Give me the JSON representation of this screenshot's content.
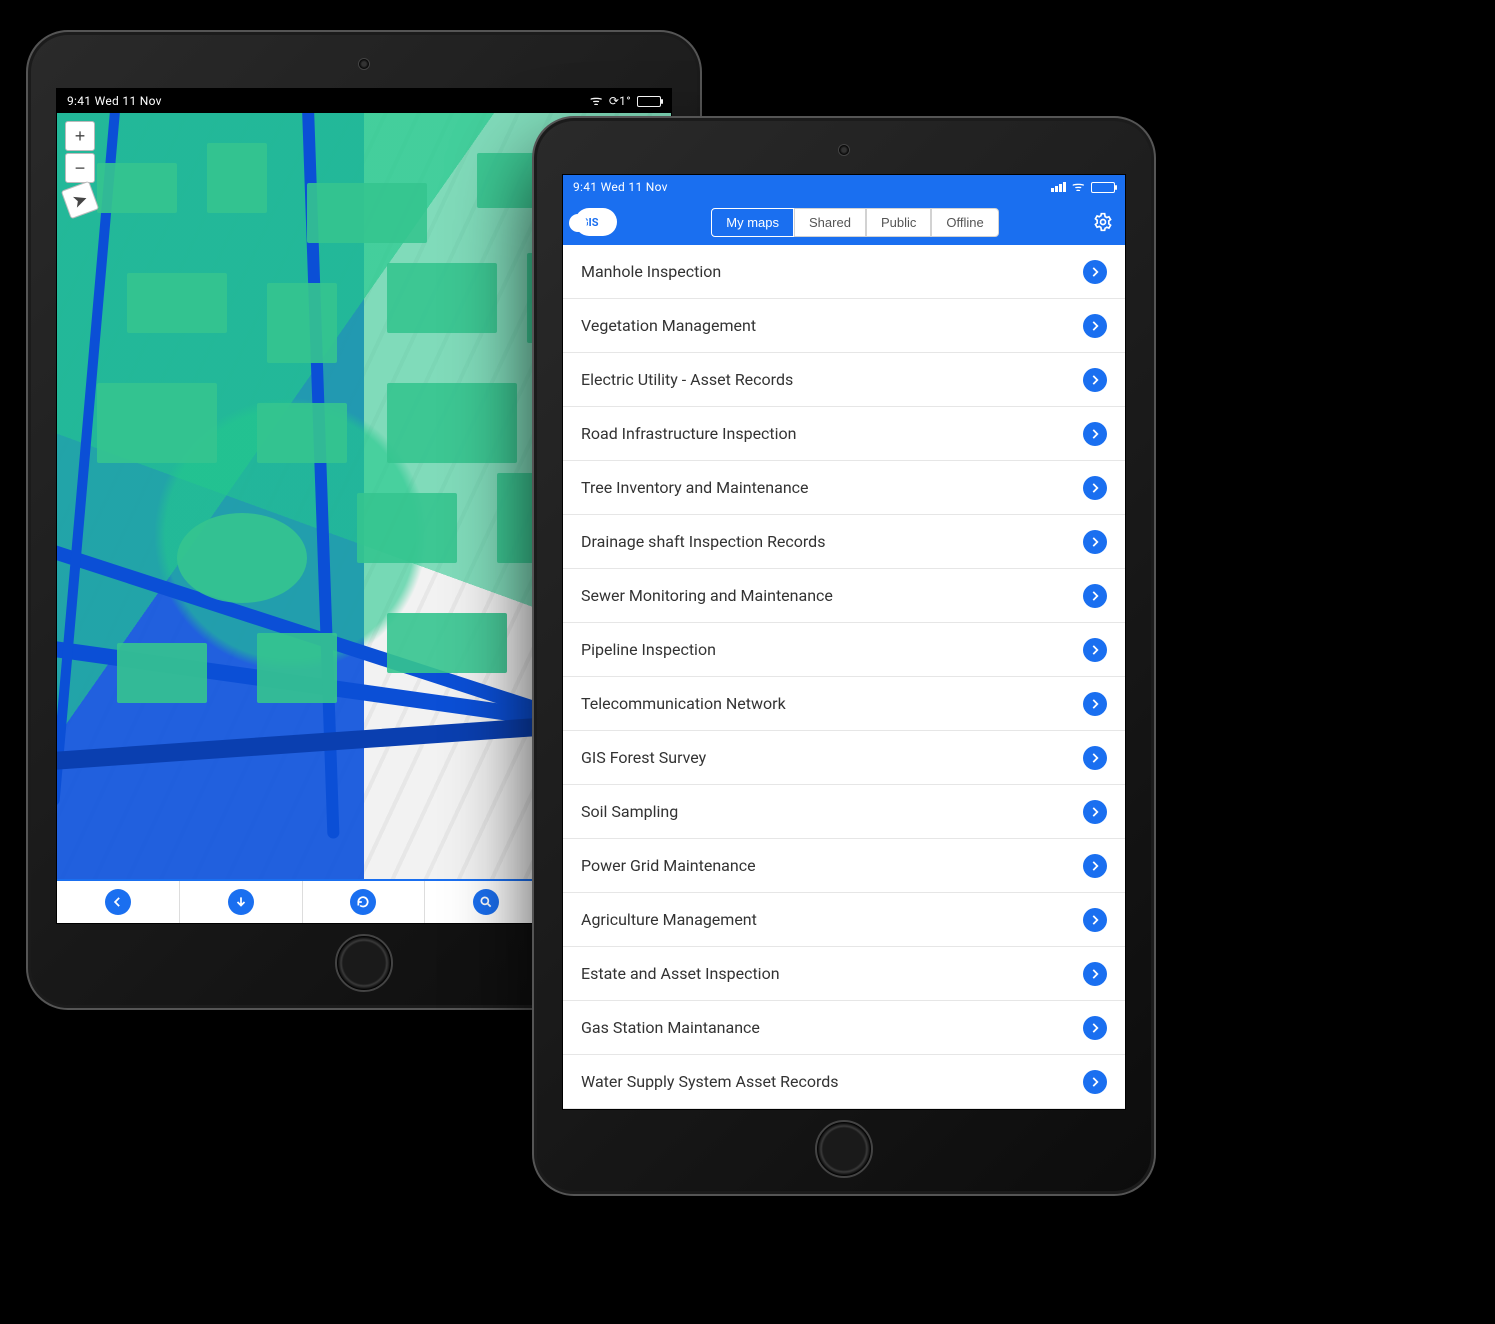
{
  "status": {
    "time": "9:41",
    "date": "Wed 11 Nov"
  },
  "brand": "GIS",
  "header": {
    "tabs": [
      {
        "label": "My maps",
        "active": true
      },
      {
        "label": "Shared",
        "active": false
      },
      {
        "label": "Public",
        "active": false
      },
      {
        "label": "Offline",
        "active": false
      }
    ]
  },
  "maps": [
    "Manhole Inspection",
    "Vegetation Management",
    "Electric Utility - Asset Records",
    "Road Infrastructure Inspection",
    "Tree Inventory and Maintenance",
    "Drainage shaft Inspection Records",
    "Sewer Monitoring and Maintenance",
    "Pipeline Inspection",
    "Telecommunication Network",
    "GIS Forest Survey",
    "Soil Sampling",
    "Power Grid Maintenance",
    "Agriculture Management",
    "Estate and Asset Inspection",
    "Gas Station Maintanance",
    "Water Supply System Asset Records"
  ],
  "map_controls": {
    "zoom_in": "+",
    "zoom_out": "−",
    "locate": "➤"
  },
  "bottom_icons": [
    "undo-icon",
    "download-icon",
    "refresh-icon",
    "zoom-icon",
    "more-icon"
  ],
  "colors": {
    "accent": "#1a6ff0",
    "green": "#35c48f"
  }
}
